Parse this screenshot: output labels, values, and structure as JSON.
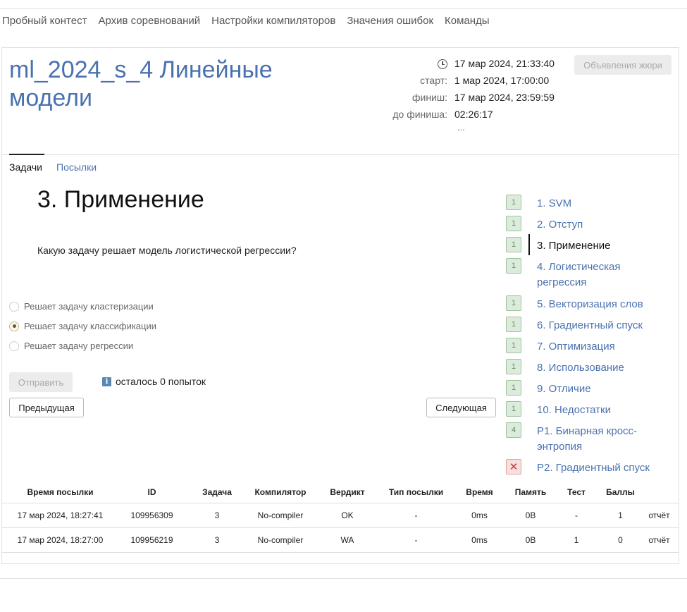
{
  "topnav": {
    "items": [
      "Пробный контест",
      "Архив соревнований",
      "Настройки компиляторов",
      "Значения ошибок",
      "Команды"
    ]
  },
  "contest": {
    "title": "ml_2024_s_4 Линейные модели",
    "current_time": "17 мар 2024, 21:33:40",
    "start_label": "старт:",
    "start_value": "1 мар 2024, 17:00:00",
    "finish_label": "финиш:",
    "finish_value": "17 мар 2024, 23:59:59",
    "remaining_label": "до финиша:",
    "remaining_value": "02:26:17",
    "ellipsis": "...",
    "jury_button": "Объявления жюри"
  },
  "tabs": {
    "problems": "Задачи",
    "submissions": "Посылки"
  },
  "problem": {
    "title": "3. Применение",
    "question": "Какую задачу решает модель логистической регрессии?",
    "options": [
      {
        "label": "Решает задачу кластеризации",
        "checked": false
      },
      {
        "label": "Решает задачу классификации",
        "checked": true
      },
      {
        "label": "Решает задачу регрессии",
        "checked": false
      }
    ],
    "send_button": "Отправить",
    "attempts_info": "осталось 0 попыток",
    "prev_button": "Предыдущая",
    "next_button": "Следующая"
  },
  "problem_list": [
    {
      "badge": "1",
      "label": "1. SVM",
      "status": "ok"
    },
    {
      "badge": "1",
      "label": "2. Отступ",
      "status": "ok"
    },
    {
      "badge": "1",
      "label": "3. Применение",
      "status": "ok",
      "current": true
    },
    {
      "badge": "1",
      "label": "4. Логистическая регрессия",
      "status": "ok"
    },
    {
      "badge": "1",
      "label": "5. Векторизация слов",
      "status": "ok"
    },
    {
      "badge": "1",
      "label": "6. Градиентный спуск",
      "status": "ok"
    },
    {
      "badge": "1",
      "label": "7. Оптимизация",
      "status": "ok"
    },
    {
      "badge": "1",
      "label": "8. Использование",
      "status": "ok"
    },
    {
      "badge": "1",
      "label": "9. Отличие",
      "status": "ok"
    },
    {
      "badge": "1",
      "label": "10. Недостатки",
      "status": "ok"
    },
    {
      "badge": "4",
      "label": "P1. Бинарная кросс-энтропия",
      "status": "ok"
    },
    {
      "badge": "✕",
      "label": "P2. Градиентный спуск",
      "status": "fail"
    }
  ],
  "submissions": {
    "headers": [
      "Время посылки",
      "ID",
      "Задача",
      "Компилятор",
      "Вердикт",
      "Тип посылки",
      "Время",
      "Память",
      "Тест",
      "Баллы",
      ""
    ],
    "rows": [
      [
        "17 мар 2024, 18:27:41",
        "109956309",
        "3",
        "No-compiler",
        "OK",
        "-",
        "0ms",
        "0B",
        "-",
        "1",
        "отчёт"
      ],
      [
        "17 мар 2024, 18:27:00",
        "109956219",
        "3",
        "No-compiler",
        "WA",
        "-",
        "0ms",
        "0B",
        "1",
        "0",
        "отчёт"
      ]
    ]
  },
  "colors": {
    "link": "#4a72b0",
    "ok": "#3c9a3c",
    "wa": "#d03030"
  }
}
